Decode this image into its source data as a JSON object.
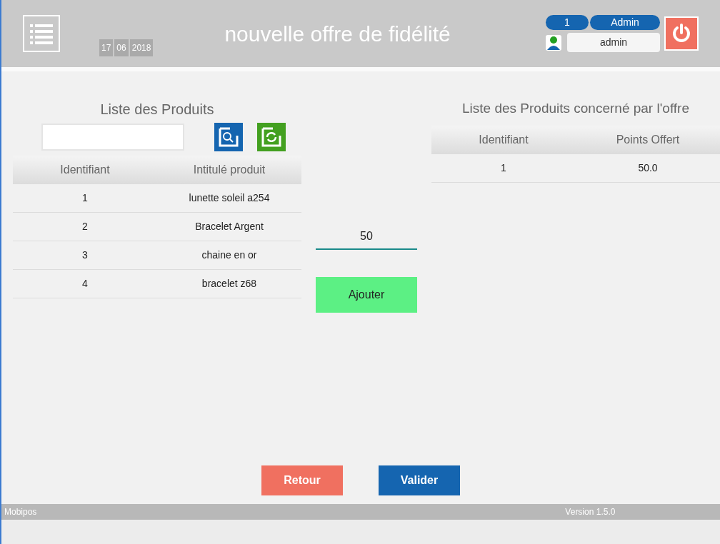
{
  "header": {
    "date": [
      "17",
      "06",
      "2018"
    ],
    "title": "nouvelle offre de fidélité",
    "user_count": "1",
    "role": "Admin",
    "username": "admin"
  },
  "products": {
    "title": "Liste des Produits",
    "columns": [
      "Identifiant",
      "Intitulé produit"
    ],
    "rows": [
      [
        "1",
        "lunette soleil a254"
      ],
      [
        "2",
        "Bracelet Argent"
      ],
      [
        "3",
        "chaine en or"
      ],
      [
        "4",
        "bracelet z68"
      ]
    ]
  },
  "points": {
    "value": "50",
    "button": "Ajouter"
  },
  "offer": {
    "title": "Liste des Produits concerné par l'offre",
    "columns": [
      "Identifiant",
      "Points Offert"
    ],
    "rows": [
      [
        "1",
        "50.0"
      ]
    ]
  },
  "buttons": {
    "back": "Retour",
    "submit": "Valider"
  },
  "footer": {
    "app": "Mobipos",
    "version": "Version 1.5.0"
  }
}
